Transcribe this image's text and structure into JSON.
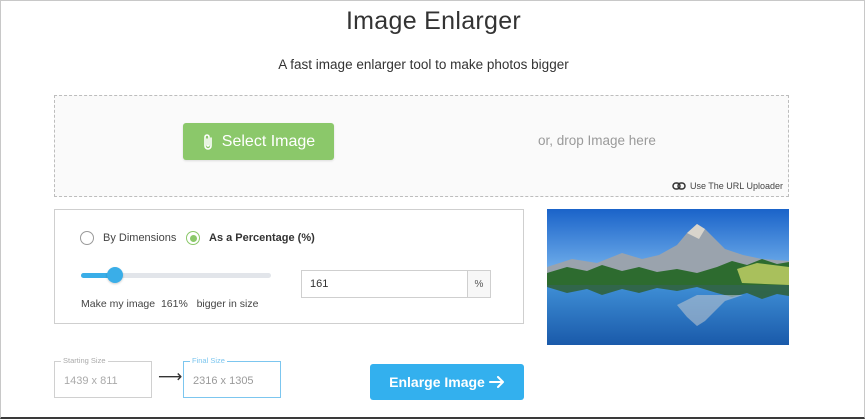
{
  "header": {
    "title": "Image Enlarger",
    "subtitle": "A fast image enlarger tool to make photos bigger"
  },
  "dropzone": {
    "select_label": "Select Image",
    "drop_text": "or, drop Image here",
    "url_uploader_label": "Use The URL Uploader"
  },
  "options": {
    "radio_dimensions_label": "By Dimensions",
    "radio_percentage_label": "As a Percentage (%)",
    "selected_mode": "percentage",
    "slider_fraction": 0.18,
    "make_prefix": "Make my image",
    "make_value": "161%",
    "make_suffix": "bigger in size",
    "percent_value": "161",
    "percent_unit": "%"
  },
  "sizes": {
    "starting_label": "Starting Size",
    "starting_value": "1439 x 811",
    "final_label": "Final Size",
    "final_value": "2316 x 1305"
  },
  "actions": {
    "enlarge_label": "Enlarge Image"
  },
  "icons": {
    "select": "paperclip-icon",
    "url": "link-icon",
    "arrow": "arrow-right-icon",
    "enlarge": "arrow-right-icon"
  },
  "colors": {
    "select_button": "#8bc86a",
    "enlarge_button": "#33b0ee",
    "slider": "#3aaee8",
    "radio_checked": "#8bc86a"
  }
}
